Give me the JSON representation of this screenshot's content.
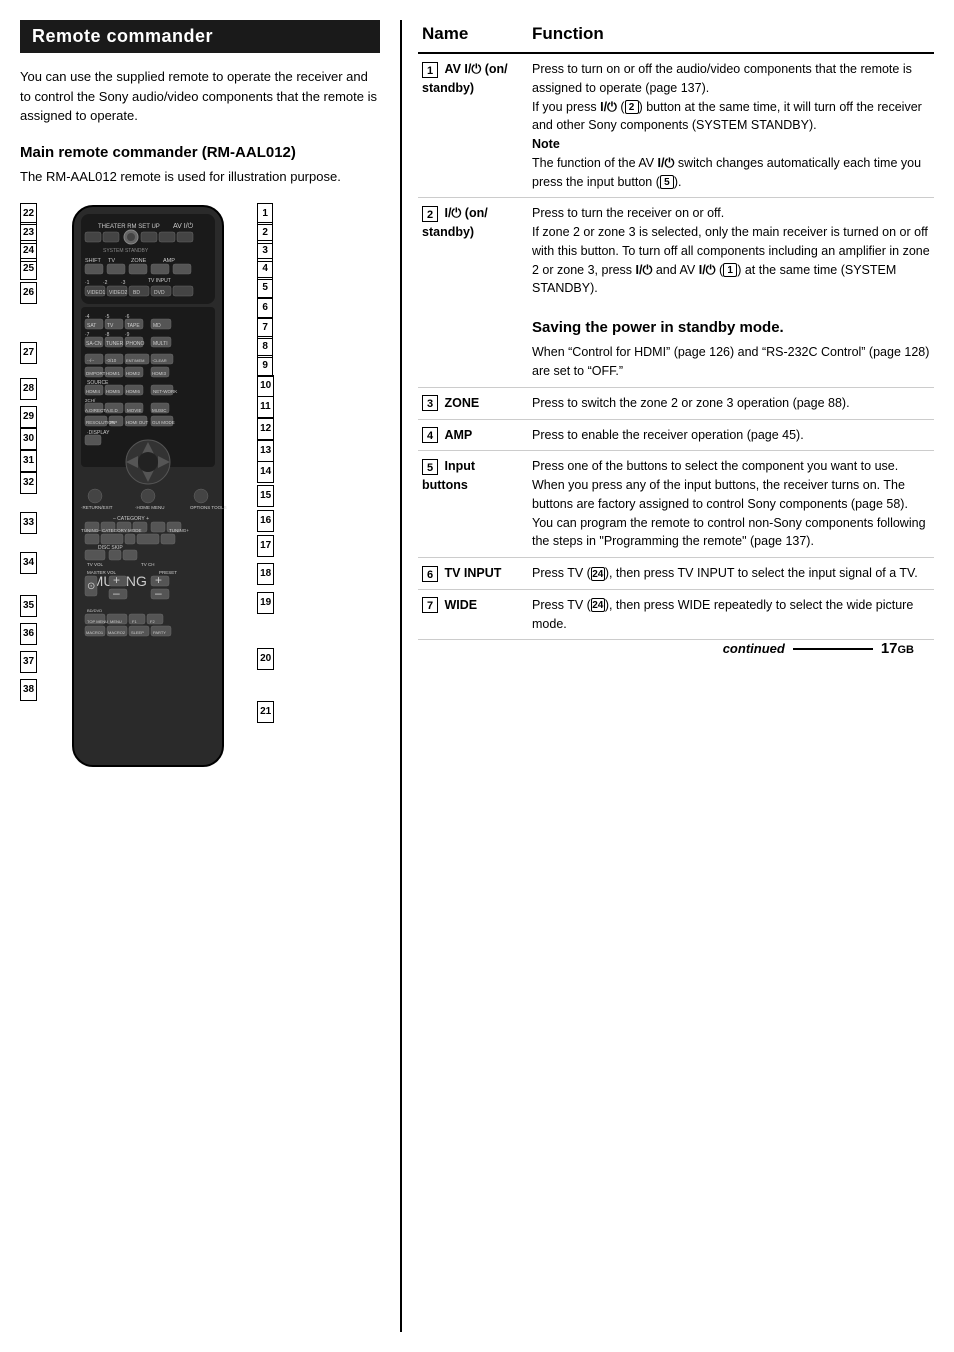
{
  "page": {
    "title": "Remote commander",
    "intro": "You can use the supplied remote to operate the receiver and to control the Sony audio/video components that the remote is assigned to operate.",
    "subsection_title": "Main remote commander (RM-AAL012)",
    "subsection_desc": "The RM-AAL012 remote is used for illustration purpose.",
    "left_numbers": [
      "22",
      "23",
      "24",
      "25",
      "26",
      "27",
      "28",
      "29",
      "30",
      "31",
      "32",
      "33",
      "34",
      "35",
      "36",
      "37",
      "38"
    ],
    "right_numbers": [
      "1",
      "2",
      "3",
      "4",
      "5",
      "6",
      "7",
      "8",
      "9",
      "10",
      "11",
      "12",
      "13",
      "14",
      "15",
      "16",
      "17",
      "18",
      "19",
      "20",
      "21"
    ],
    "table": {
      "col_name": "Name",
      "col_function": "Function",
      "rows": [
        {
          "num": "1",
          "name": "AV I/⏻ (on/ standby)",
          "function": "Press to turn on or off the audio/video components that the remote is assigned to operate (page 137).\nIf you press I/⏻ (2) button at the same time, it will turn off the receiver and other Sony components (SYSTEM STANDBY).\nNote\nThe function of the AV I/⏻ switch changes automatically each time you press the input button (5)."
        },
        {
          "num": "2",
          "name": "I/⏻ (on/ standby)",
          "function_intro": "Press to turn the receiver on or off.\nIf zone 2 or zone 3 is selected, only the main receiver is turned on or off with this button. To turn off all components including an amplifier in zone 2 or zone 3, press I/⏻ and AV I/⏻ (1) at the same time (SYSTEM STANDBY).",
          "saving_header": "Saving the power in standby mode.",
          "saving_text": "When \"Control for HDMI\" (page 126) and \"RS-232C Control\" (page 128) are set to \"OFF.\""
        },
        {
          "num": "3",
          "name": "ZONE",
          "function": "Press to switch the zone 2 or zone 3 operation (page 88)."
        },
        {
          "num": "4",
          "name": "AMP",
          "function": "Press to enable the receiver operation (page 45)."
        },
        {
          "num": "5",
          "name": "Input buttons",
          "function": "Press one of the buttons to select the component you want to use. When you press any of the input buttons, the receiver turns on. The buttons are factory assigned to control Sony components (page 58). You can program the remote to control non-Sony components following the steps in \"Programming the remote\" (page 137)."
        },
        {
          "num": "6",
          "name": "TV INPUT",
          "function": "Press TV (24), then press TV INPUT to select the input signal of a TV."
        },
        {
          "num": "7",
          "name": "WIDE",
          "function": "Press TV (24), then press WIDE repeatedly to select the wide picture mode."
        }
      ]
    },
    "footer": {
      "continued": "continued",
      "page_number": "17",
      "page_suffix": "GB"
    }
  }
}
